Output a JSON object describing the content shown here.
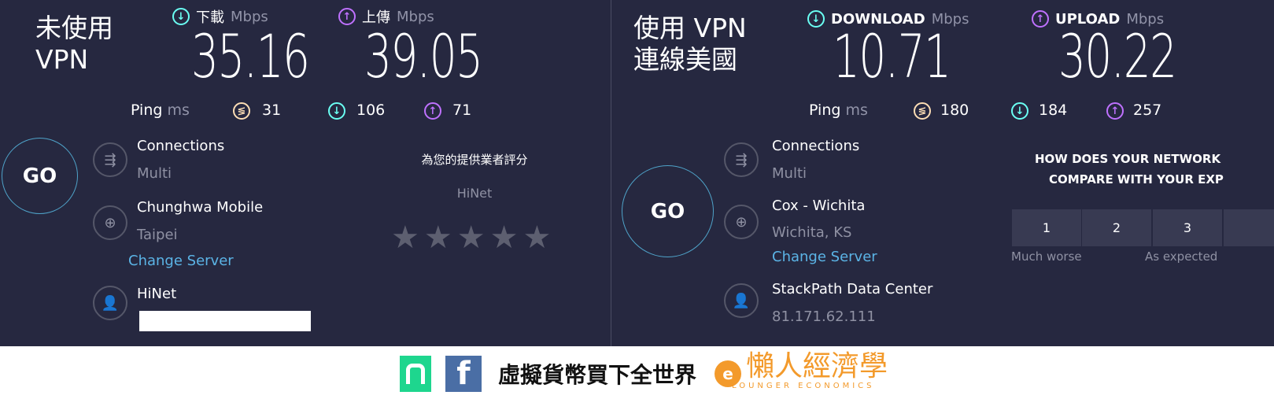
{
  "left": {
    "title_line1": "未使用",
    "title_line2": "VPN",
    "download": {
      "label": "下載",
      "unit": "Mbps",
      "value": "35.16"
    },
    "upload": {
      "label": "上傳",
      "unit": "Mbps",
      "value": "39.05"
    },
    "ping": {
      "label": "Ping",
      "unit": "ms",
      "idle": "31",
      "download": "106",
      "upload": "71"
    },
    "go": "GO",
    "connections": {
      "label": "Connections",
      "value": "Multi"
    },
    "server": {
      "name": "Chunghwa Mobile",
      "location": "Taipei",
      "change": "Change Server"
    },
    "isp": {
      "name": "HiNet"
    },
    "rating": {
      "prompt": "為您的提供業者評分",
      "provider": "HiNet",
      "stars": 5,
      "selected": 0
    }
  },
  "right": {
    "title_line1": "使用 VPN",
    "title_line2": "連線美國",
    "download": {
      "label": "DOWNLOAD",
      "unit": "Mbps",
      "value": "10.71"
    },
    "upload": {
      "label": "UPLOAD",
      "unit": "Mbps",
      "value": "30.22"
    },
    "ping": {
      "label": "Ping",
      "unit": "ms",
      "idle": "180",
      "download": "184",
      "upload": "257"
    },
    "go": "GO",
    "connections": {
      "label": "Connections",
      "value": "Multi"
    },
    "server": {
      "name": "Cox - Wichita",
      "location": "Wichita, KS",
      "change": "Change Server"
    },
    "isp": {
      "name": "StackPath Data Center",
      "ip": "81.171.62.111"
    },
    "survey": {
      "line1": "HOW DOES YOUR NETWORK",
      "line2": "COMPARE WITH YOUR EXP",
      "options": [
        "1",
        "2",
        "3",
        ""
      ],
      "low_label": "Much worse",
      "mid_label": "As expected"
    }
  },
  "footer": {
    "slogan": "虛擬貨幣買下全世界",
    "brand": "懶人經濟學",
    "brand_en": "LOUNGER ECONOMICS",
    "colors": {
      "brand": "#f39a2b",
      "green": "#1ed68e",
      "facebook": "#4a6ea5"
    }
  },
  "colors": {
    "background": "#262840",
    "download": "#6afff3",
    "upload": "#bf71ff",
    "ping": "#fddeb5",
    "link": "#5bb4e6"
  }
}
